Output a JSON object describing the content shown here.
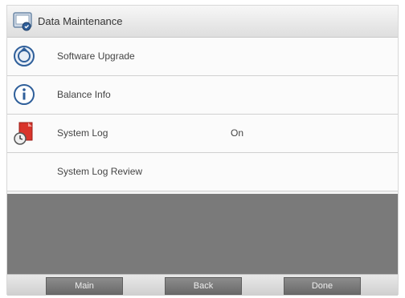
{
  "header": {
    "title": "Data Maintenance",
    "icon": "data-maintenance-icon"
  },
  "menu": {
    "items": [
      {
        "label": "Software Upgrade",
        "icon": "software-upgrade-icon",
        "value": ""
      },
      {
        "label": "Balance Info",
        "icon": "info-icon",
        "value": ""
      },
      {
        "label": "System Log",
        "icon": "system-log-icon",
        "value": "On"
      },
      {
        "label": "System Log Review",
        "icon": "",
        "value": ""
      }
    ]
  },
  "footer": {
    "main_label": "Main",
    "back_label": "Back",
    "done_label": "Done"
  },
  "colors": {
    "accent_blue": "#2f5f9a",
    "system_log_red": "#d9342b",
    "button_gray": "#7a7a7a"
  }
}
